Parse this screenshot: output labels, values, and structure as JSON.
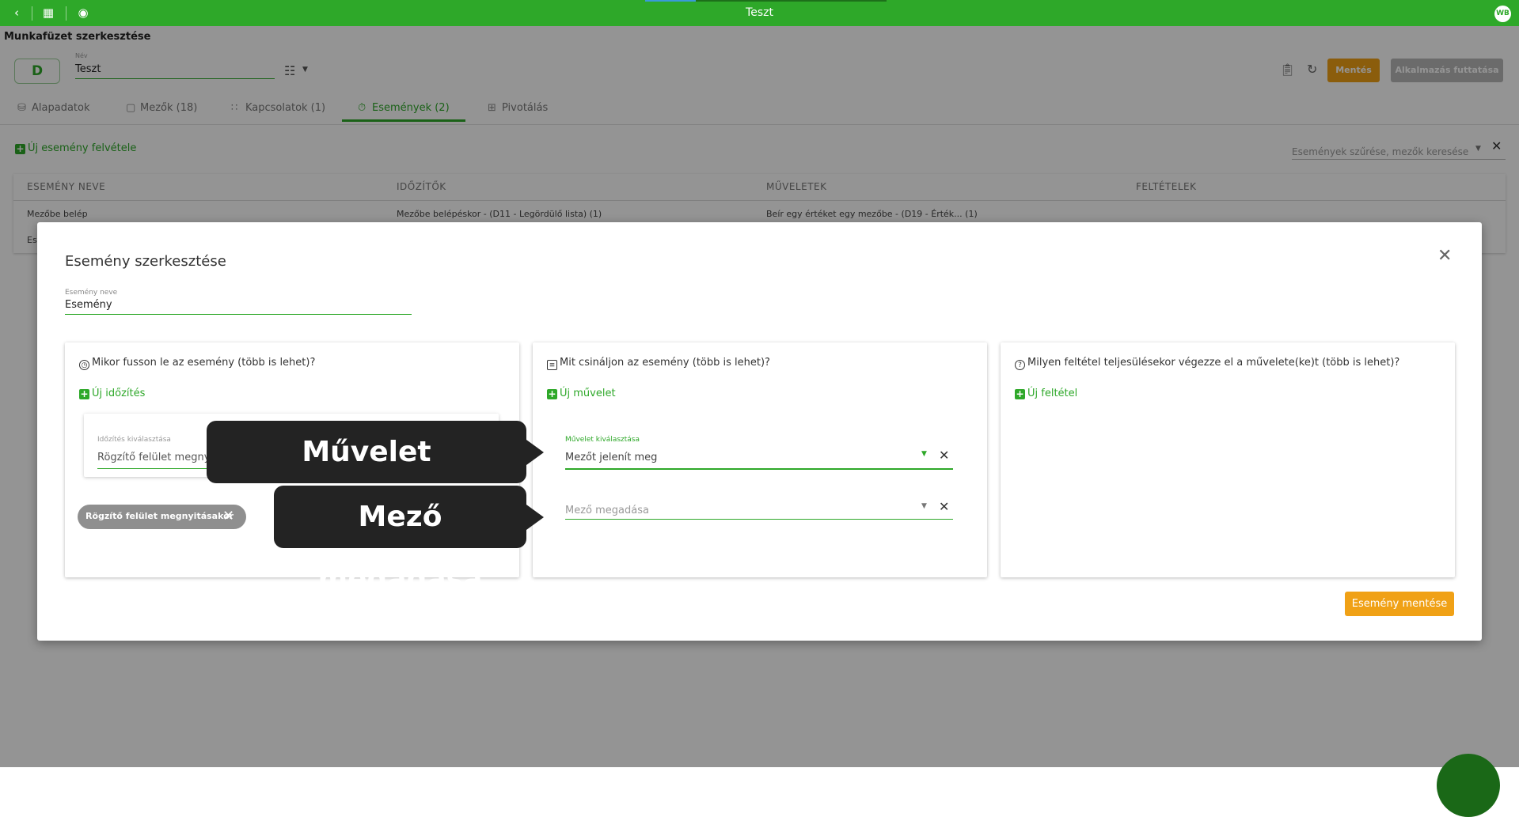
{
  "window": {
    "title": "Teszt",
    "avatar": "WB"
  },
  "topbar_icons": [
    "back-icon",
    "apps-icon",
    "play-icon"
  ],
  "header": {
    "workbook_title": "Munkafüzet szerkesztése",
    "badge": "D",
    "name_label": "Név",
    "name_value": "Teszt",
    "save_label": "Mentés",
    "run_label": "Alkalmazás futtatása"
  },
  "tabs": [
    {
      "label": "Alapadatok",
      "icon": "database-icon"
    },
    {
      "label": "Mezők (18)",
      "icon": "fields-icon"
    },
    {
      "label": "Kapcsolatok (1)",
      "icon": "relations-icon"
    },
    {
      "label": "Események (2)",
      "icon": "events-icon",
      "active": true
    },
    {
      "label": "Pivotálás",
      "icon": "pivot-icon"
    }
  ],
  "events": {
    "add_label": "Új esemény felvétele",
    "filter_placeholder": "Események szűrése, mezők keresése",
    "columns": [
      "ESEMÉNY NEVE",
      "IDŐZÍTŐK",
      "MŰVELETEK",
      "FELTÉTELEK"
    ],
    "rows": [
      {
        "name": "Mezőbe belép",
        "timers": "Mezőbe belépéskor - (D11 - Legördülő lista)  (1)",
        "actions": "Beír egy értéket egy mezőbe - (D19 - Érték...  (1)",
        "conditions": ""
      },
      {
        "name": "Es",
        "timers": "",
        "actions": "",
        "conditions": ""
      }
    ]
  },
  "modal": {
    "title": "Esemény szerkesztése",
    "name_label": "Esemény neve",
    "name_value": "Esemény",
    "panels": [
      {
        "title": "Mikor fusson le az esemény (több is lehet)?",
        "add_label": "Új időzítés"
      },
      {
        "title": "Mit csináljon az esemény (több is lehet)?",
        "add_label": "Új művelet"
      },
      {
        "title": "Milyen feltétel teljesülésekor végezze el a művelete(ke)t (több is lehet)?",
        "add_label": "Új feltétel"
      }
    ],
    "timing": {
      "label": "Időzítés kiválasztása",
      "value": "Rögzítő felület megnyitásakor",
      "chip": "Rögzítő felület megnyitásakor"
    },
    "action": {
      "label": "Művelet kiválasztása",
      "value": "Mezőt jelenít meg",
      "field_placeholder": "Mező megadása"
    },
    "save_label": "Esemény mentése"
  },
  "callouts": [
    "Művelet kiválasztása",
    "Mező megadása"
  ],
  "colors": {
    "primary": "#2ea829",
    "accent": "#f0a116",
    "callout": "#232323"
  }
}
